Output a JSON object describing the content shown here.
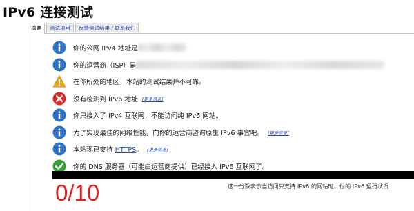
{
  "page": {
    "title": "IPv6 连接测试"
  },
  "tabs": [
    {
      "label": "摘要",
      "active": true
    },
    {
      "label": "测试项目",
      "active": false
    },
    {
      "label": "反馈测试结果 / 联系我们",
      "active": false
    }
  ],
  "results": [
    {
      "icon": "info-icon",
      "text": "你的公网 IPv4 地址是"
    },
    {
      "icon": "info-icon",
      "text": "你的运营商（ISP）是"
    },
    {
      "icon": "warning-icon",
      "text": "在你所处的地区，本站的测试结果并不可靠。"
    },
    {
      "icon": "error-icon",
      "text": "没有检测到 IPv6 地址",
      "link": "[更多信息]"
    },
    {
      "icon": "info-icon",
      "text": "你只接入了 IPv4 互联网，不能访问纯 IPv6 网站。"
    },
    {
      "icon": "info-icon",
      "text": "为了实现最佳的网络性能，向你的运营商咨询原生 IPv6 事宜吧。",
      "link": "[更多信息]"
    },
    {
      "icon": "info-icon",
      "text_before": "本站现已支持 ",
      "link_inline": "HTTPS",
      "text_after": "。",
      "link": "[更多信息]"
    },
    {
      "icon": "check-icon",
      "text": "你的 DNS 服务器（可能由运营商提供）已经接入 IPv6 互联网了。"
    }
  ],
  "score": {
    "value": "0/10",
    "note": "这一分数表示当访问只支持 IPv6 的网站时，你的 IPv6 运行状况"
  },
  "colors": {
    "info": "#2e72c6",
    "warning": "#e8a91c",
    "error": "#d8282a",
    "ok": "#3aa13a",
    "score": "#e02020",
    "link": "#2a4aa8"
  }
}
